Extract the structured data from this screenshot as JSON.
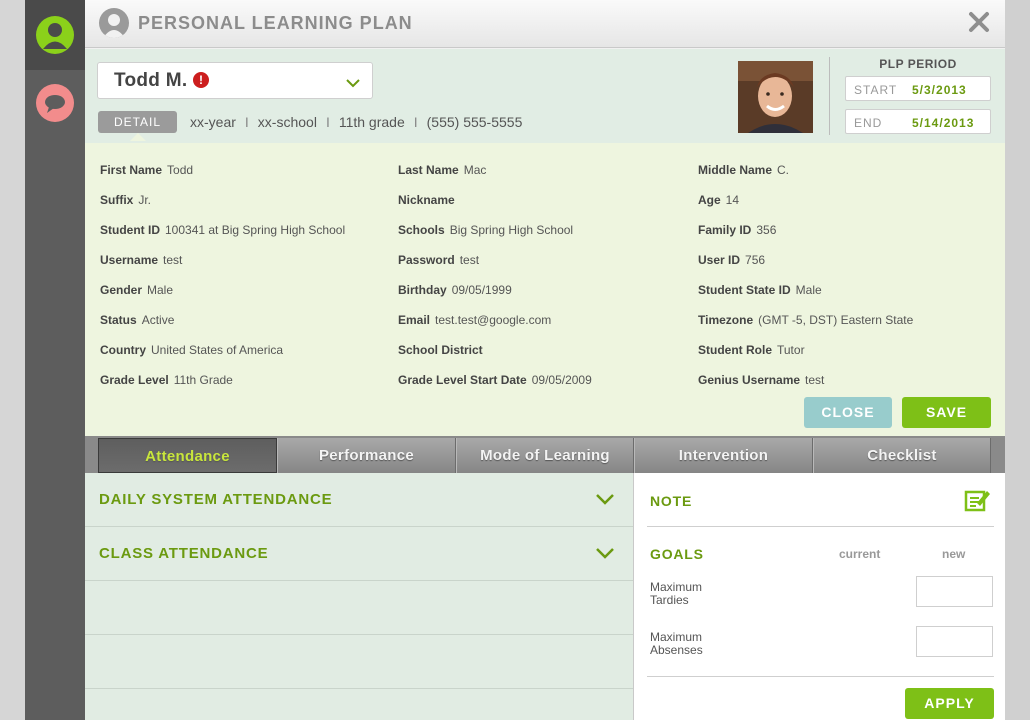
{
  "window": {
    "title": "PERSONAL LEARNING PLAN"
  },
  "student": {
    "name": "Todd M.",
    "alert": "!",
    "detail_label": "DETAIL",
    "info": [
      "xx-year",
      "xx-school",
      "11th grade",
      "(555) 555-5555"
    ],
    "separator": "I"
  },
  "plp": {
    "label": "PLP PERIOD",
    "start_label": "START",
    "start": "5/3/2013",
    "end_label": "END",
    "end": "5/14/2013"
  },
  "details": {
    "col1": [
      {
        "label": "First Name",
        "value": "Todd"
      },
      {
        "label": "Suffix",
        "value": "Jr."
      },
      {
        "label": "Student ID",
        "value": "100341 at Big Spring High School"
      },
      {
        "label": "Username",
        "value": "test"
      },
      {
        "label": "Gender",
        "value": "Male"
      },
      {
        "label": "Status",
        "value": "Active"
      },
      {
        "label": "Country",
        "value": "United States of America"
      },
      {
        "label": "Grade Level",
        "value": "11th Grade"
      }
    ],
    "col2": [
      {
        "label": "Last Name",
        "value": "Mac"
      },
      {
        "label": "Nickname",
        "value": ""
      },
      {
        "label": "Schools",
        "value": "Big Spring High School"
      },
      {
        "label": "Password",
        "value": "test"
      },
      {
        "label": "Birthday",
        "value": "09/05/1999"
      },
      {
        "label": "Email",
        "value": "test.test@google.com"
      },
      {
        "label": "School District",
        "value": ""
      },
      {
        "label": "Grade Level Start Date",
        "value": "09/05/2009"
      }
    ],
    "col3": [
      {
        "label": "Middle Name",
        "value": "C."
      },
      {
        "label": "Age",
        "value": "14"
      },
      {
        "label": "Family ID",
        "value": "356"
      },
      {
        "label": "User ID",
        "value": "756"
      },
      {
        "label": "Student State ID",
        "value": "Male"
      },
      {
        "label": "Timezone",
        "value": "(GMT -5, DST) Eastern State"
      },
      {
        "label": "Student Role",
        "value": "Tutor"
      },
      {
        "label": "Genius Username",
        "value": "test"
      }
    ],
    "close_label": "CLOSE",
    "save_label": "SAVE"
  },
  "tabs": [
    "Attendance",
    "Performance",
    "Mode of Learning",
    "Intervention",
    "Checklist"
  ],
  "attendance": {
    "sections": [
      "DAILY SYSTEM ATTENDANCE",
      "CLASS ATTENDANCE"
    ]
  },
  "side": {
    "note_label": "NOTE",
    "goals_label": "GOALS",
    "col_current": "current",
    "col_new": "new",
    "goals": [
      {
        "label_1": "Maximum",
        "label_2": "Tardies"
      },
      {
        "label_1": "Maximum",
        "label_2": "Absenses"
      }
    ],
    "apply_label": "APPLY"
  },
  "colors": {
    "accent_green": "#7ec017",
    "text_green": "#6b9a10",
    "close_teal": "#98cccc",
    "alert_red": "#cc1e1e"
  }
}
